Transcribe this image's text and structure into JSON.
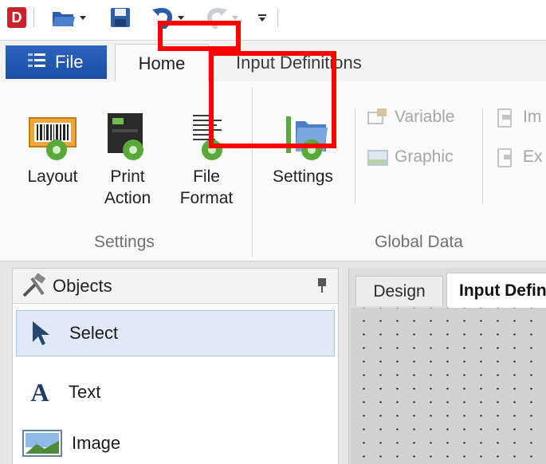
{
  "quick_access": {
    "app_icon_letter": "D",
    "items": [
      "app-icon",
      "open-folder-icon",
      "save-icon",
      "undo-icon",
      "redo-icon",
      "customize-icon"
    ]
  },
  "tabs": {
    "file": "File",
    "home": "Home",
    "input_definitions": "Input Definitions"
  },
  "ribbon": {
    "settings_group": {
      "label": "Settings",
      "buttons": [
        "Layout",
        "Print Action",
        "File Format"
      ]
    },
    "global_data_group": {
      "label": "Global Data",
      "settings_button": "Settings",
      "variable_button": "Variable",
      "graphic_button": "Graphic"
    },
    "cut_off": {
      "import_fragment": "Im",
      "export_fragment": "Ex"
    }
  },
  "objects_panel": {
    "title": "Objects",
    "items": [
      {
        "label": "Select",
        "icon": "cursor-arrow-icon",
        "selected": true
      },
      {
        "label": "Text",
        "icon": "text-A-icon",
        "selected": false
      },
      {
        "label": "Image",
        "icon": "image-icon",
        "selected": false
      }
    ]
  },
  "document_tabs": {
    "design": "Design",
    "input_definitions": "Input Definitions"
  },
  "colors": {
    "file_tab": "#1c4ea5",
    "highlight": "#ff0000",
    "selection_bg": "#dfe9f7"
  }
}
